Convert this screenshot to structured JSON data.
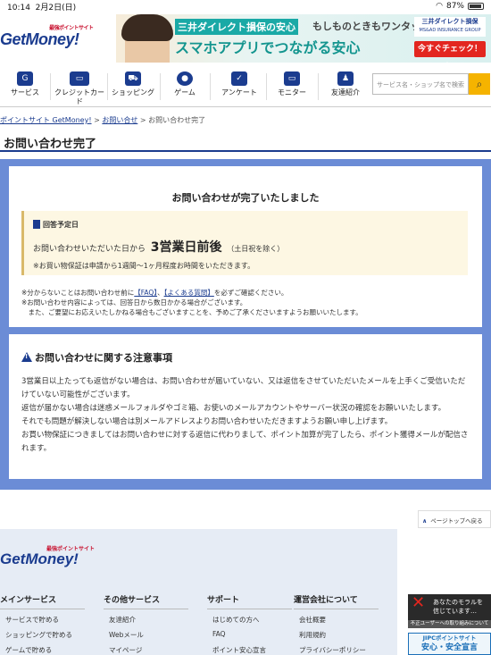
{
  "statusbar": {
    "time": "10:14",
    "date": "2月2日(日)",
    "battery": "87%"
  },
  "header": {
    "logo": "GetMoney!",
    "logo_sub": "最強ポイントサイト",
    "banner": {
      "line1": "三井ダイレクト損保の安心",
      "line1b": "もしものときもワンタップ",
      "line2": "スマホアプリでつながる安心",
      "brand": "三井ダイレクト損保",
      "brand_en": "MS&AD INSURANCE GROUP",
      "cta": "今すぐチェック！ ▶"
    }
  },
  "nav": {
    "items": [
      {
        "label": "サービス",
        "icon": "service-icon"
      },
      {
        "label": "クレジットカード",
        "icon": "credit-card-icon"
      },
      {
        "label": "ショッピング",
        "icon": "shopping-cart-icon"
      },
      {
        "label": "ゲーム",
        "icon": "game-icon"
      },
      {
        "label": "アンケート",
        "icon": "survey-icon"
      },
      {
        "label": "モニター",
        "icon": "monitor-icon"
      },
      {
        "label": "友達紹介",
        "icon": "friend-icon"
      }
    ],
    "search_placeholder": "サービス名・ショップ名で検索"
  },
  "breadcrumb": {
    "home": "ポイントサイト GetMoney!",
    "parent": "お問い合せ",
    "current": "お問い合わせ完了"
  },
  "page_title": "お問い合わせ完了",
  "complete": {
    "heading": "お問い合わせが完了いたしました",
    "due_label": "回答予定日",
    "due_prefix": "お問い合わせいただいた日から",
    "due_value": "3営業日前後",
    "due_suffix": "（土日祝を除く）",
    "due_note": "※お買い物保証は申請から1週間〜1ヶ月程度お時間をいただきます。",
    "note1_pre": "※分からないことはお問い合わせ前に",
    "note1_faq": "【FAQ】",
    "note1_sep": "、",
    "note1_qa": "【よくある質問】",
    "note1_post": "を必ずご確認ください。",
    "note2": "※お問い合わせ内容によっては、回答日から数日かかる場合がございます。",
    "note3": "　また、ご要望にお応えいたしかねる場合もございますことを、予めご了承くださいますようお願いいたします。"
  },
  "caution": {
    "heading": "お問い合わせに関する注意事項",
    "body": [
      "3営業日以上たっても返信がない場合は、お問い合わせが届いていない、又は返信をさせていただいたメールを上手くご受信いただけていない可能性がございます。",
      "返信が届かない場合は迷惑メールフォルダやゴミ箱、お使いのメールアカウントやサーバー状況の確認をお願いいたします。",
      "それでも問題が解決しない場合は別メールアドレスよりお問い合わせいただきますようお願い申し上げます。",
      "お買い物保証につきましてはお問い合わせに対する返信に代わりまして、ポイント加算が完了したら、ポイント獲得メールが配信されます。"
    ]
  },
  "pagetop": "ページトップへ戻る",
  "footer": {
    "logo": "GetMoney!",
    "logo_sub": "最強ポイントサイト",
    "columns": [
      {
        "heading": "メインサービス",
        "items": [
          "サービスで貯める",
          "ショッピングで貯める",
          "ゲームで貯める"
        ]
      },
      {
        "heading": "その他サービス",
        "items": [
          "友達紹介",
          "Webメール",
          "マイページ"
        ]
      },
      {
        "heading": "サポート",
        "items": [
          "はじめての方へ",
          "FAQ",
          "ポイント安心宣言"
        ]
      },
      {
        "heading": "運営会社について",
        "items": [
          "会社概要",
          "利用規約",
          "プライバシーポリシー"
        ]
      }
    ]
  },
  "side_ads": {
    "ad1_text": "あなたのモラルを信じています…",
    "ad1_caption": "不正ユーザーへの取り組みについて",
    "ad2_top": "JIPCポイントサイト",
    "ad2_big": "安心・安全宣言"
  }
}
